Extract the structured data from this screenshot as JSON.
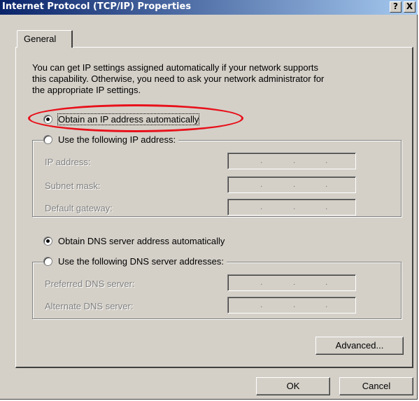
{
  "window": {
    "title": "Internet Protocol (TCP/IP) Properties",
    "help_glyph": "?",
    "close_glyph": "X"
  },
  "tabs": [
    {
      "label": "General",
      "selected": true
    }
  ],
  "description": {
    "lines": [
      "You can get IP settings assigned automatically if your network supports",
      "this capability. Otherwise, you need to ask your network administrator for",
      "the appropriate IP settings."
    ]
  },
  "ip_section": {
    "auto_option": {
      "label": "Obtain an IP address automatically",
      "selected": true
    },
    "manual_option": {
      "label": "Use the following IP address:",
      "selected": false
    },
    "fields": [
      {
        "label": "IP address:"
      },
      {
        "label": "Subnet mask:"
      },
      {
        "label": "Default gateway:"
      }
    ]
  },
  "dns_section": {
    "auto_option": {
      "label": "Obtain DNS server address automatically",
      "selected": true
    },
    "manual_option": {
      "label": "Use the following DNS server addresses:",
      "selected": false
    },
    "fields": [
      {
        "label": "Preferred DNS server:"
      },
      {
        "label": "Alternate DNS server:"
      }
    ]
  },
  "ip_separator": ".",
  "buttons": {
    "advanced": "Advanced...",
    "ok": "OK",
    "cancel": "Cancel"
  },
  "annotation": {
    "color": "#e8101a",
    "shape": "ellipse"
  }
}
